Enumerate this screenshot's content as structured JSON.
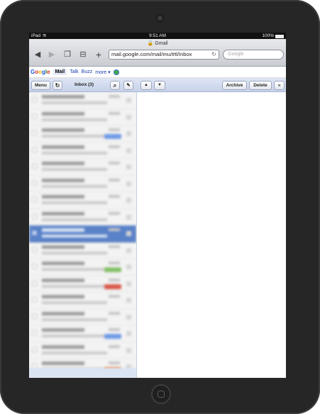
{
  "device": {
    "model": "iPad"
  },
  "status_bar": {
    "carrier": "iPad",
    "wifi": "wifi-icon",
    "time": "9:51 AM",
    "battery": "100%"
  },
  "safari": {
    "page_title": "Gmail",
    "url": "mail.google.com/mail/mu/#tl/Inbox",
    "search_placeholder": "Google"
  },
  "google_bar": {
    "logo": [
      "G",
      "o",
      "o",
      "g",
      "l",
      "e"
    ],
    "logo_colors": [
      "#1a56d6",
      "#d62d20",
      "#f5b400",
      "#1a56d6",
      "#138a36",
      "#d62d20"
    ],
    "tabs": [
      {
        "label": "Mail",
        "active": true
      },
      {
        "label": "Talk"
      },
      {
        "label": "Buzz"
      },
      {
        "label": "more ▾"
      }
    ]
  },
  "gmail_toolbar": {
    "menu_label": "Menu",
    "refresh_icon": "↻",
    "inbox_label": "Inbox (3)",
    "search_icon": "⌕",
    "compose_icon": "✎",
    "up_icon": "▲",
    "down_icon": "▼",
    "archive_label": "Archive",
    "delete_label": "Delete",
    "more_icon": "»"
  },
  "message_list": {
    "selected_index": 8,
    "label_colors": [
      "",
      "",
      "#6f9ae6",
      "",
      "",
      "",
      "",
      "",
      "",
      "",
      "#86c06a",
      "#d95a4a",
      "",
      "",
      "#6f9ae6",
      "",
      "#e88a4a",
      ""
    ]
  }
}
